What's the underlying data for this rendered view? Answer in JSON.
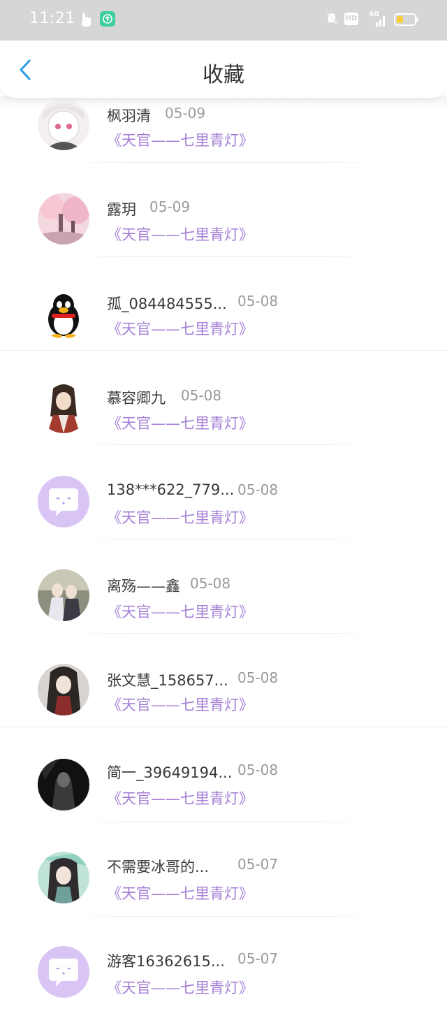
{
  "status_bar": {
    "time": "11:21",
    "hd": "HD",
    "network": "4G"
  },
  "header": {
    "title": "收藏"
  },
  "items": [
    {
      "name": "枫羽清",
      "date": "05-09",
      "book": "《天官——七里青灯》",
      "avatar": "anime-girl-white-hair"
    },
    {
      "name": "露玥",
      "date": "05-09",
      "book": "《天官——七里青灯》",
      "avatar": "anime-pink-scene"
    },
    {
      "name": "孤_084484555...",
      "date": "05-08",
      "book": "《天官——七里青灯》",
      "avatar": "qq-penguin"
    },
    {
      "name": "慕容卿九",
      "date": "05-08",
      "book": "《天官——七里青灯》",
      "avatar": "anime-boy-red"
    },
    {
      "name": "138***622_779...",
      "date": "05-08",
      "book": "《天官——七里青灯》",
      "avatar": "default-chat-bubble"
    },
    {
      "name": "离殇——鑫",
      "date": "05-08",
      "book": "《天官——七里青灯》",
      "avatar": "anime-two-figures"
    },
    {
      "name": "张文慧_158657...",
      "date": "05-08",
      "book": "《天官——七里青灯》",
      "avatar": "anime-dark-hair"
    },
    {
      "name": "简一_39649194...",
      "date": "05-08",
      "book": "《天官——七里青灯》",
      "avatar": "dark-silhouette"
    },
    {
      "name": "不需要冰哥的...",
      "date": "05-07",
      "book": "《天官——七里青灯》",
      "avatar": "anime-green"
    },
    {
      "name": "游客16362615...",
      "date": "05-07",
      "book": "《天官——七里青灯》",
      "avatar": "default-chat-bubble"
    }
  ],
  "colors": {
    "accent_book": "#a47fd6",
    "back_arrow": "#2a9be8",
    "status_bar_bg": "#d6d6d6",
    "default_avatar": "#d9c5f5"
  }
}
